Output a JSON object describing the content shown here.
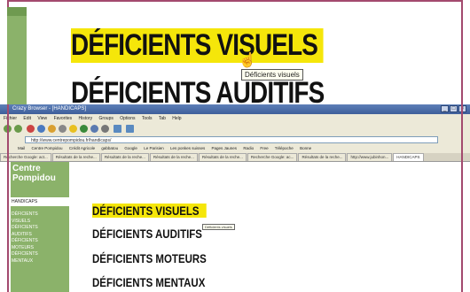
{
  "zoom": {
    "title_1": "DÉFICIENTS VISUELS",
    "title_2": "DÉFICIENTS AUDITIFS",
    "tooltip": "Déficients visuels"
  },
  "browser": {
    "window_title": "Crazy Browser - [HANDICAPS]",
    "menu": [
      "Fichier",
      "Edit",
      "View",
      "Favorites",
      "History",
      "Groups",
      "Options",
      "Tools",
      "Tab",
      "Help"
    ],
    "address": "http://www.centrepompidou.fr/handicaps/",
    "bookmarks": [
      "Mail",
      "Centre Pompidou",
      "Crédit Agricole",
      "gabbatou",
      "Google",
      "Le Parisien",
      "Les ponkes suisses",
      "Pages Jaunes",
      "Radio",
      "Free",
      "Télépoche",
      "Bonne"
    ],
    "tabs": [
      "Recherche Google: act...",
      "Résultats de la reche...",
      "Résultats de la reche...",
      "Résultats de la reche...",
      "Résultats de la reche...",
      "Recherche Google: ac...",
      "Résultats de la reche...",
      "http://www.jubinhon...",
      "HANDICAPS"
    ]
  },
  "page": {
    "logo": "Centre Pompidou",
    "section": "HANDICAPS",
    "side_links": [
      "DÉFICIENTS",
      "VISUELS",
      "DÉFICIENTS",
      "AUDITIFS",
      "DÉFICIENTS",
      "MOTEURS",
      "DÉFICIENTS",
      "MENTAUX"
    ],
    "menu_1": "DÉFICIENTS VISUELS",
    "menu_2": "DÉFICIENTS AUDITIFS",
    "menu_3": "DÉFICIENTS MOTEURS",
    "menu_4": "DÉFICIENTS MENTAUX",
    "tooltip": "Déficients visuels"
  },
  "colors": {
    "highlight": "#f5e60a",
    "sidebar_green": "#8bb26a",
    "frame": "#a34a6e"
  }
}
